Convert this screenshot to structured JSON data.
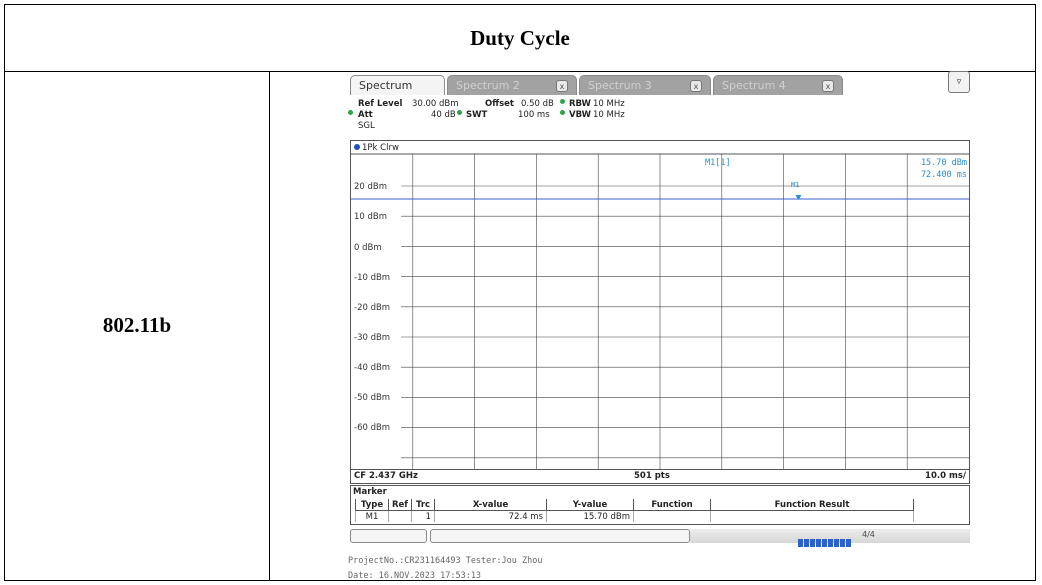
{
  "table": {
    "title": "Duty Cycle",
    "row_label": "802.11b"
  },
  "analyzer": {
    "tabs": [
      {
        "label": "Spectrum",
        "active": true
      },
      {
        "label": "Spectrum 2",
        "active": false
      },
      {
        "label": "Spectrum 3",
        "active": false
      },
      {
        "label": "Spectrum 4",
        "active": false
      }
    ],
    "tab_close_glyph": "x",
    "params": {
      "ref_level_label": "Ref Level",
      "ref_level_value": "30.00 dBm",
      "offset_label": "Offset",
      "offset_value": "0.50 dB",
      "rbw_label": "RBW",
      "rbw_value": "10 MHz",
      "att_label": "Att",
      "att_value": "40 dB",
      "swt_label": "SWT",
      "swt_value": "100 ms",
      "vbw_label": "VBW",
      "vbw_value": "10 MHz",
      "sgl": "SGL"
    },
    "trace_label": "1Pk Clrw",
    "y_axis_labels": [
      "20 dBm",
      "10 dBm",
      "0 dBm",
      "-10 dBm",
      "-20 dBm",
      "-30 dBm",
      "-40 dBm",
      "-50 dBm",
      "-60 dBm"
    ],
    "marker_readout": {
      "name": "M1[1]",
      "level": "15.70 dBm",
      "time": "72.400 ms",
      "marker_tag": "M1"
    },
    "footer": {
      "center": "CF 2.437 GHz",
      "points": "501 pts",
      "span": "10.0 ms/"
    },
    "marker_table": {
      "title": "Marker",
      "headers": [
        "Type",
        "Ref",
        "Trc",
        "X-value",
        "Y-value",
        "Function",
        "Function Result"
      ],
      "rows": [
        [
          "M1",
          "",
          "1",
          "72.4 ms",
          "15.70 dBm",
          "",
          ""
        ]
      ]
    },
    "status_text": "4/4"
  },
  "caption": {
    "line1": "ProjectNo.:CR231164493  Tester:Jou Zhou",
    "line2": "Date: 16.NOV.2023  17:53:13"
  },
  "colors": {
    "trace": "#3a5fd0",
    "marker": "#2a8fd4",
    "grid": "#444444"
  }
}
